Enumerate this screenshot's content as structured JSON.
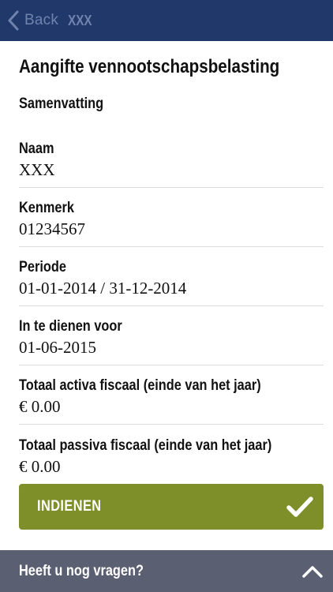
{
  "navbar": {
    "back_label": "Back",
    "title": "XXX",
    "bg_color": "#21386b",
    "text_color": "#6f83ad"
  },
  "page": {
    "title": "Aangifte vennootschapsbelasting",
    "section_title": "Samenvatting"
  },
  "fields": [
    {
      "label": "Naam",
      "value": "XXX"
    },
    {
      "label": "Kenmerk",
      "value": "01234567"
    },
    {
      "label": "Periode",
      "value": "01-01-2014 / 31-12-2014"
    },
    {
      "label": "In te dienen voor",
      "value": "01-06-2015"
    },
    {
      "label": "Totaal activa fiscaal (einde van het jaar)",
      "value": "€ 0.00"
    },
    {
      "label": "Totaal passiva fiscaal (einde van het jaar)",
      "value": "€ 0.00"
    }
  ],
  "submit": {
    "label": "INDIENEN",
    "icon": "checkmark-icon",
    "color": "#7e8f2a"
  },
  "help": {
    "label": "Heeft u nog vragen?",
    "icon": "chevron-up-icon",
    "color": "#5a5f72"
  }
}
